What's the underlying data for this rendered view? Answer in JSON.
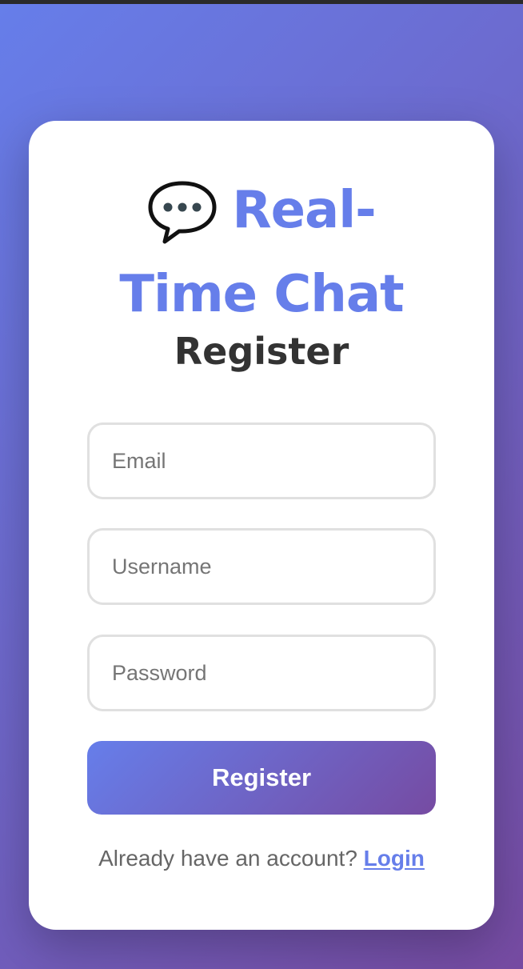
{
  "app": {
    "title_line1": "Real-",
    "title_line2": "Time Chat",
    "icon": "speech-bubble-icon",
    "brand_color": "#667eea",
    "gradient_end": "#764ba2"
  },
  "form": {
    "heading": "Register",
    "email_placeholder": "Email",
    "email_value": "",
    "username_placeholder": "Username",
    "username_value": "",
    "password_placeholder": "Password",
    "password_value": "",
    "submit_label": "Register"
  },
  "footer": {
    "prompt": "Already have an account?",
    "login_label": "Login"
  }
}
